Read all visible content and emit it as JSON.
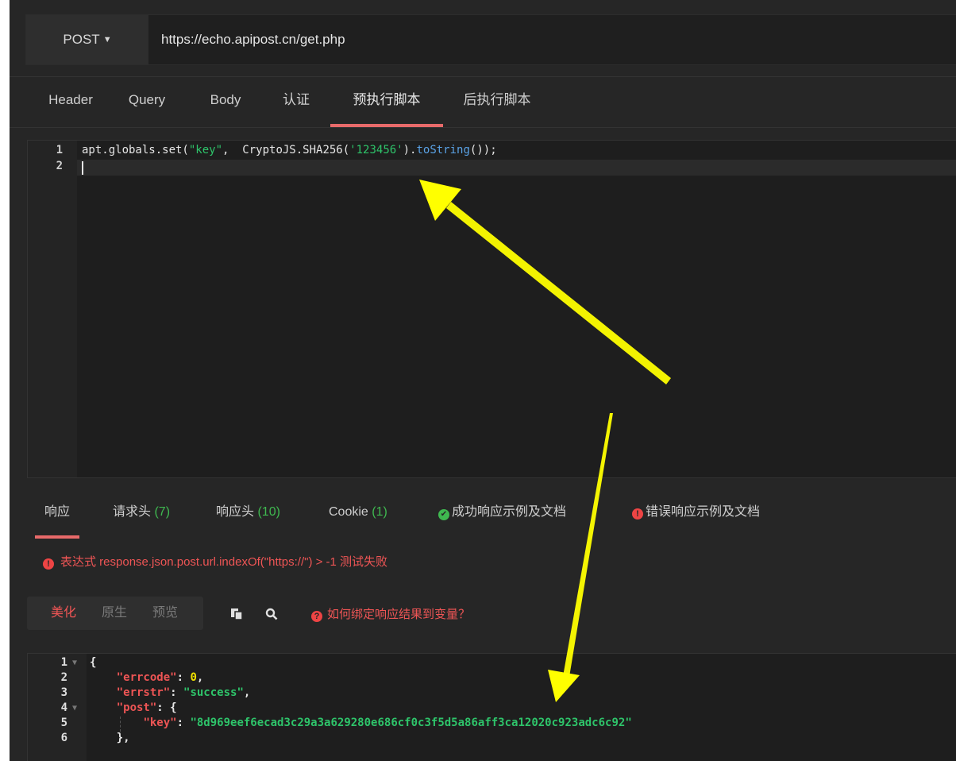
{
  "request": {
    "method": "POST",
    "url": "https://echo.apipost.cn/get.php"
  },
  "tabs": [
    "Header",
    "Query",
    "Body",
    "认证",
    "预执行脚本",
    "后执行脚本"
  ],
  "active_tab": "预执行脚本",
  "script_editor": {
    "line_numbers": [
      "1",
      "2"
    ],
    "code": {
      "part1": "apt.globals.set(",
      "str1": "\"key\"",
      "part2": ",  CryptoJS.SHA256(",
      "str2": "'123456'",
      "part3": ").",
      "fn": "toString",
      "part4": "());"
    }
  },
  "response_tabs": {
    "response": "响应",
    "req_headers": "请求头",
    "req_headers_count": "(7)",
    "resp_headers": "响应头",
    "resp_headers_count": "(10)",
    "cookie": "Cookie",
    "cookie_count": "(1)",
    "success_docs": "成功响应示例及文档",
    "error_docs": "错误响应示例及文档"
  },
  "test_message": "表达式 response.json.post.url.indexOf(\"https://\") > -1 测试失败",
  "view_modes": [
    "美化",
    "原生",
    "预览"
  ],
  "active_view_mode": "美化",
  "help_link": "如何绑定响应结果到变量？",
  "icons": {
    "copy": "copy-icon",
    "search": "search-icon",
    "success": "check-circle-icon",
    "error": "exclamation-circle-icon",
    "help": "question-circle-icon"
  },
  "response_body": {
    "line_numbers": [
      "1",
      "2",
      "3",
      "4",
      "5",
      "6"
    ],
    "open_brace": "{",
    "errcode_key": "\"errcode\"",
    "errcode_value": "0",
    "errstr_key": "\"errstr\"",
    "errstr_value": "\"success\"",
    "post_key": "\"post\"",
    "key_key": "\"key\"",
    "key_value": "\"8d969eef6ecad3c29a3a629280e686cf0c3f5d5a86aff3ca12020c923adc6c92\"",
    "close": "},"
  },
  "colors": {
    "accent": "#e86a6a",
    "error": "#ee5555",
    "success": "#3fb950",
    "annotation_arrow": "#ffff00"
  }
}
